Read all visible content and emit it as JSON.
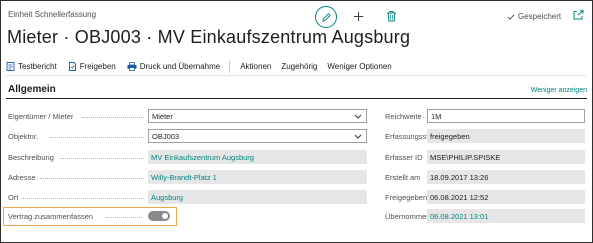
{
  "header": {
    "caption": "Einheit Schnellerfassung",
    "title": "Mieter · OBJ003 · MV Einkaufszentrum Augsburg",
    "saved_label": "Gespeichert"
  },
  "toolbar": {
    "items": [
      "Testbericht",
      "Freigeben",
      "Druck und Übernahme",
      "Aktionen",
      "Zugehörig",
      "Weniger Optionen"
    ]
  },
  "section": {
    "title": "Allgemein",
    "show_less": "Weniger anzeigen"
  },
  "fields_left": [
    {
      "label": "Eigentümer / Mieter",
      "value": "Mieter"
    },
    {
      "label": "Objektnr.",
      "value": "OBJ003"
    },
    {
      "label": "Beschreibung",
      "value": "MV Einkaufszentrum Augsburg"
    },
    {
      "label": "Adresse",
      "value": "Willy-Brandt-Platz 1"
    },
    {
      "label": "Ort",
      "value": "Augsburg"
    },
    {
      "label": "Vertrag zusammenfassen",
      "value": ""
    }
  ],
  "fields_right": [
    {
      "label": "Reichweite",
      "value": "1M"
    },
    {
      "label": "Erfassungsstatus",
      "value": "freigegeben"
    },
    {
      "label": "Erfasser ID",
      "value": "MSE\\PHILIP.SPISKE"
    },
    {
      "label": "Erstellt am",
      "value": "18.09.2017 13:26"
    },
    {
      "label": "Freigegeben am",
      "value": "06.08.2021 12:52"
    },
    {
      "label": "Übernommen am",
      "value": "06.08.2021 13:01"
    }
  ],
  "colors": {
    "accent": "#00857f",
    "highlight": "#f0a64b",
    "readonly_bg": "#e6e6e6"
  }
}
